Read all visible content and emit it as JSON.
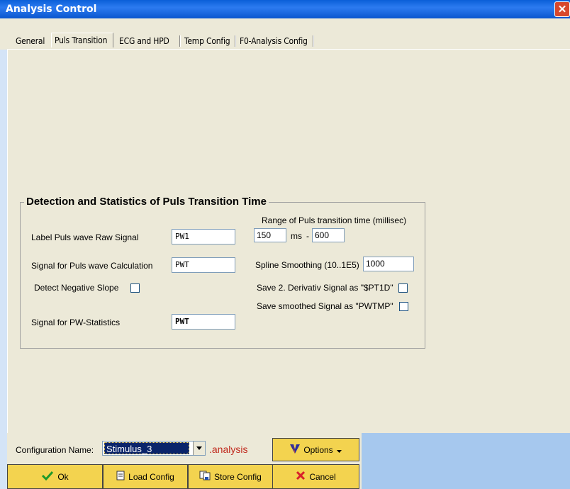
{
  "window": {
    "title": "Analysis Control",
    "close_glyph": "✕"
  },
  "tabs": [
    "General",
    "Puls Transition",
    "ECG and HPD",
    "Temp Config",
    "F0-Analysis Config"
  ],
  "group": {
    "title": "Detection and Statistics of Puls Transition Time",
    "label_raw": "Label Puls wave Raw Signal",
    "value_raw": "PW1",
    "label_calc": "Signal for Puls wave Calculation",
    "value_calc": "PWT",
    "label_negative": "Detect Negative Slope",
    "label_stats": "Signal for PW-Statistics",
    "value_stats": "PWT",
    "range_heading": "Range of Puls transition time (millisec)",
    "range_min": "150",
    "range_unit": "ms",
    "range_dash": "-",
    "range_max": "600",
    "label_spline": "Spline Smoothing (10..1E5)",
    "value_spline": "1000",
    "label_deriv": "Save 2. Derivativ Signal as \"$PT1D\"",
    "label_smoothed": "Save smoothed Signal as \"PWTMP\""
  },
  "config": {
    "label": "Configuration Name:",
    "value": "Stimulus_3",
    "suffix": ".analysis",
    "suffix_color": "#c0281c"
  },
  "buttons": {
    "options": "Options",
    "ok": "Ok",
    "load": "Load Config",
    "store": "Store Config",
    "cancel": "Cancel"
  },
  "colors": {
    "button_bg": "#f3d34f",
    "title_blue": "#0a5fd8",
    "panel": "#ece9d8",
    "right_panel": "#a6c8ee"
  }
}
